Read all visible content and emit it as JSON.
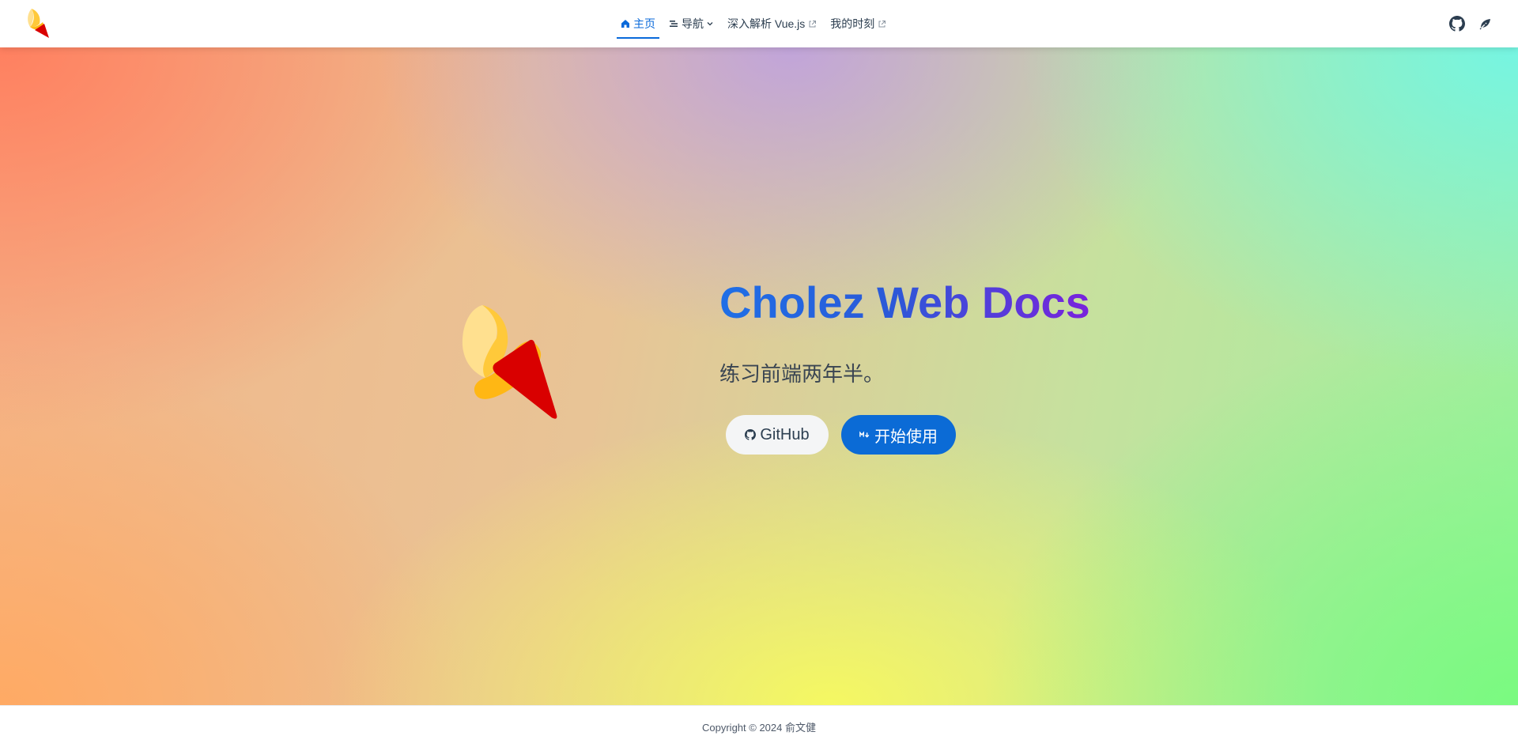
{
  "nav": {
    "items": [
      {
        "label": "主页",
        "icon": "home-icon",
        "active": true
      },
      {
        "label": "导航",
        "icon": "list-icon",
        "dropdown": true
      },
      {
        "label": "深入解析 Vue.js",
        "external": true
      },
      {
        "label": "我的时刻",
        "external": true
      }
    ],
    "right_icons": [
      "github-icon",
      "theme-toggle-icon"
    ]
  },
  "hero": {
    "title": "Cholez Web Docs",
    "tagline": "练习前端两年半。",
    "actions": [
      {
        "label": "GitHub",
        "icon": "github-icon"
      },
      {
        "label": "开始使用",
        "icon": "markdown-icon"
      }
    ]
  },
  "footer": {
    "copyright": "Copyright © 2024 俞文健"
  },
  "colors": {
    "accent": "#0969da",
    "primary_button": "#0b6bd6",
    "title_gradient_start": "#1f6fe6",
    "title_gradient_end": "#7a22dc",
    "cone_red": "#d90000",
    "cream_light": "#ffdf8a",
    "cream_dark": "#ffb714"
  }
}
